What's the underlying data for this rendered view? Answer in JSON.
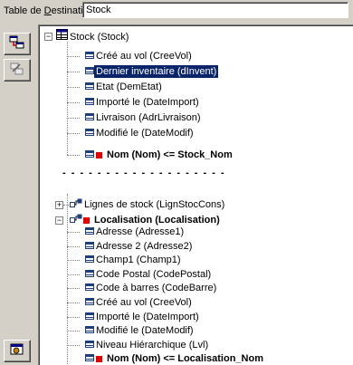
{
  "destination": {
    "label_before_underline": "Table de ",
    "label_underlined": "D",
    "label_after_underline": "estination :",
    "value": "Stock"
  },
  "toolbar": {
    "buttons": [
      {
        "icon": "add-link-icon"
      },
      {
        "icon": "edit-link-icon"
      },
      {
        "icon": "settings-icon"
      }
    ]
  },
  "tree": {
    "root": {
      "label": "Stock (Stock)",
      "children": [
        {
          "label": "Créé au vol (CreeVol)"
        },
        {
          "label": "Dernier inventaire (dInvent)",
          "selected": true
        },
        {
          "label": "Etat (DemEtat)"
        },
        {
          "label": "Importé le (DateImport)"
        },
        {
          "label": "Livraison (AdrLivraison)"
        },
        {
          "label": "Modifié le (DateModif)"
        },
        {
          "label": "Nom (Nom)  <=  Stock_Nom",
          "key": true
        }
      ]
    },
    "separator": "- - - - - - - - - - - - - - - - - - -",
    "link_lines": {
      "label": "Lignes de stock (LignStocCons)"
    },
    "link_localisation": {
      "label": "Localisation (Localisation)",
      "children": [
        {
          "label": "Adresse (Adresse1)"
        },
        {
          "label": "Adresse 2 (Adresse2)"
        },
        {
          "label": "Champ1 (Champ1)"
        },
        {
          "label": "Code Postal (CodePostal)"
        },
        {
          "label": "Code à barres (CodeBarre)"
        },
        {
          "label": "Créé au vol (CreeVol)"
        },
        {
          "label": "Importé le (DateImport)"
        },
        {
          "label": "Modifié le (DateModif)"
        },
        {
          "label": "Niveau Hiérarchique (Lvl)"
        },
        {
          "label": "Nom (Nom)  <=  Localisation_Nom",
          "key": true
        }
      ]
    }
  },
  "colors": {
    "selection": "#0a246a",
    "key_marker": "#e00000",
    "field_icon": "#1f3f7a"
  }
}
